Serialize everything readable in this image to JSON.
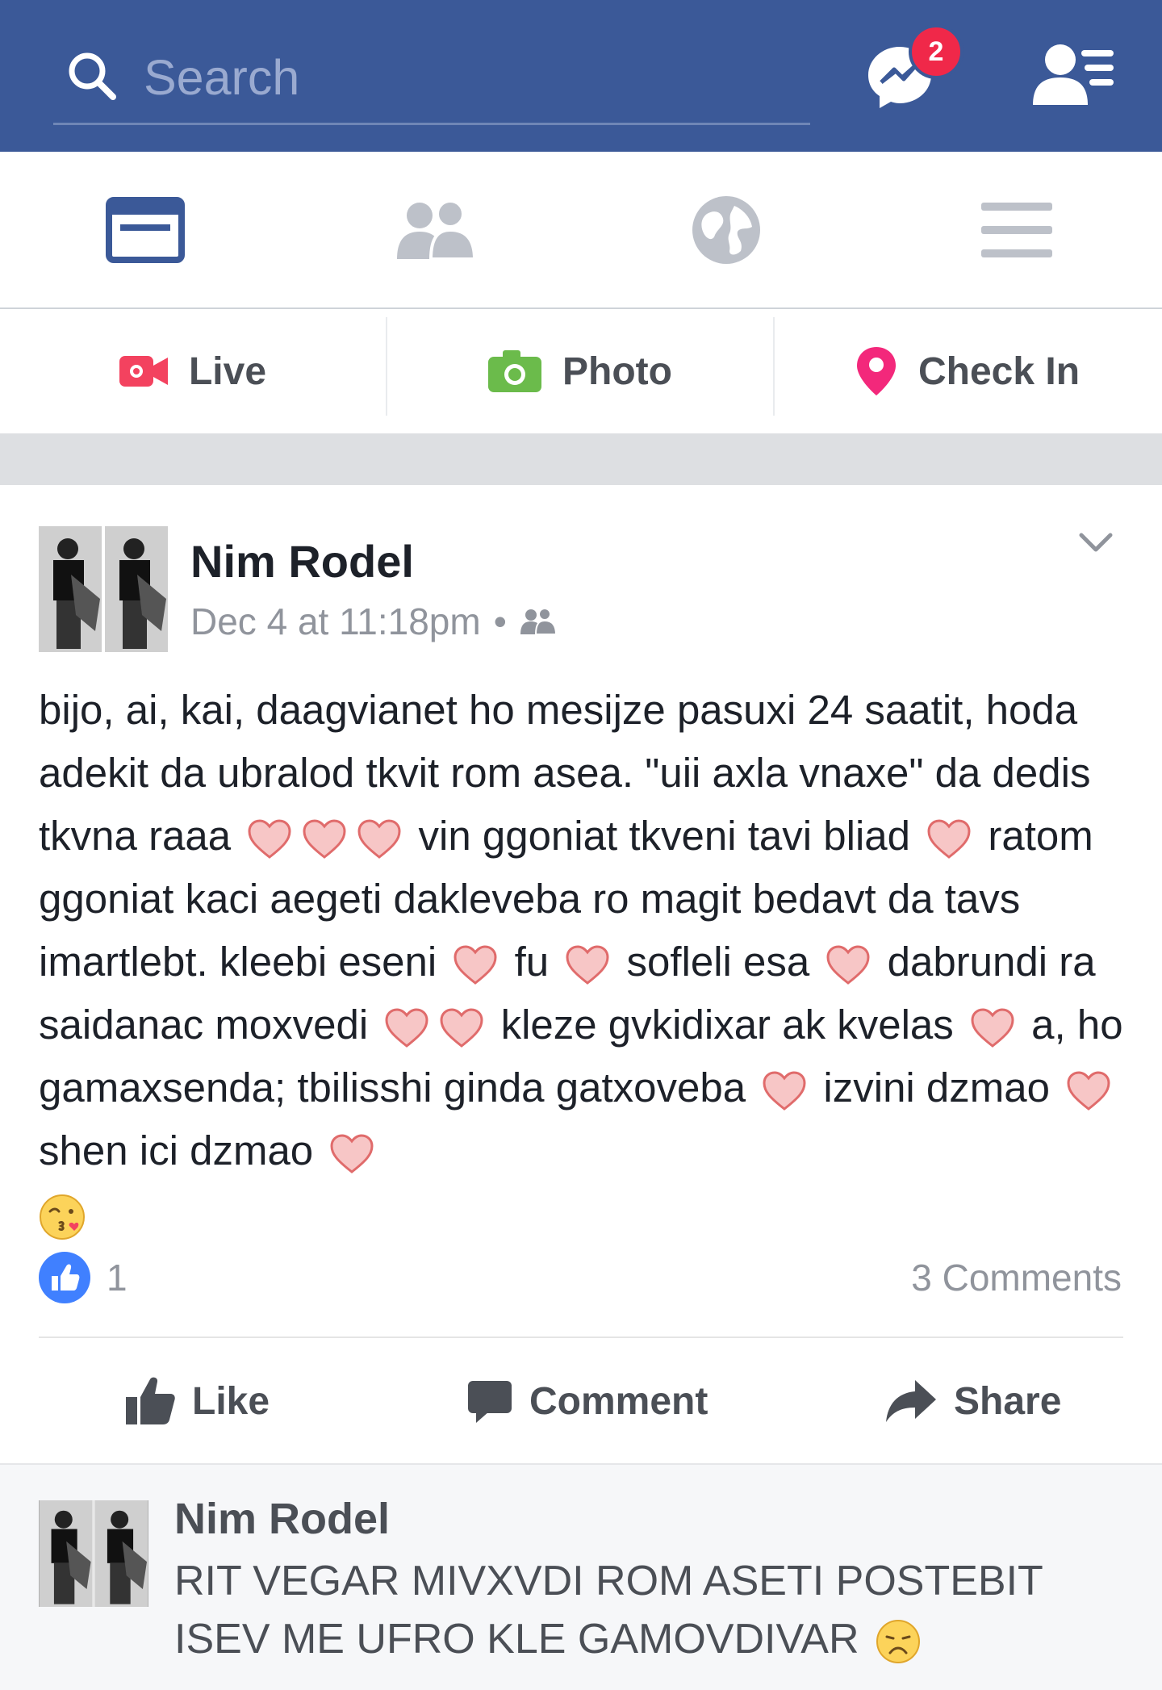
{
  "header": {
    "search_placeholder": "Search",
    "messenger_badge": "2",
    "colors": {
      "bar": "#3b5998",
      "badge": "#f02849"
    },
    "icons": [
      "search-icon",
      "messenger-icon",
      "friend-requests-icon"
    ]
  },
  "nav": {
    "items": [
      {
        "name": "news-feed",
        "icon": "news-feed-icon",
        "active": true
      },
      {
        "name": "friends",
        "icon": "friends-icon",
        "active": false
      },
      {
        "name": "notifications",
        "icon": "globe-icon",
        "active": false
      },
      {
        "name": "menu",
        "icon": "hamburger-menu-icon",
        "active": false
      }
    ]
  },
  "composer": {
    "live_label": "Live",
    "photo_label": "Photo",
    "checkin_label": "Check In"
  },
  "post": {
    "author": "Nim Rodel",
    "timestamp": "Dec 4 at 11:18pm",
    "separator": "•",
    "audience_icon": "friends-audience-icon",
    "text_segments": [
      "bijo, ai, kai, daagvianet ho mesijze pasuxi 24 saatit, hoda adekit da ubralod tkvit rom asea. \"uii axla vnaxe\" da dedis tkvna raaa ",
      " vin ggoniat tkveni tavi bliad ",
      " ratom ggoniat kaci aegeti dakleveba ro magit bedavt da tavs imartlebt. kleebi eseni ",
      " fu ",
      " sofleli esa ",
      " dabrundi ra saidanac moxvedi ",
      " kleze gvkidixar ak kvelas ",
      " a, ho gamaxsenda; tbilisshi ginda gatxoveba ",
      " izvini dzmao ",
      " shen ici dzmao "
    ],
    "like_count": "1",
    "comments_count": "3 Comments",
    "actions": {
      "like": "Like",
      "comment": "Comment",
      "share": "Share"
    }
  },
  "comment": {
    "author": "Nim Rodel",
    "text": "RIT VEGAR MIVXVDI ROM ASETI POSTEBIT ISEV ME UFRO KLE GAMOVDIVAR"
  }
}
